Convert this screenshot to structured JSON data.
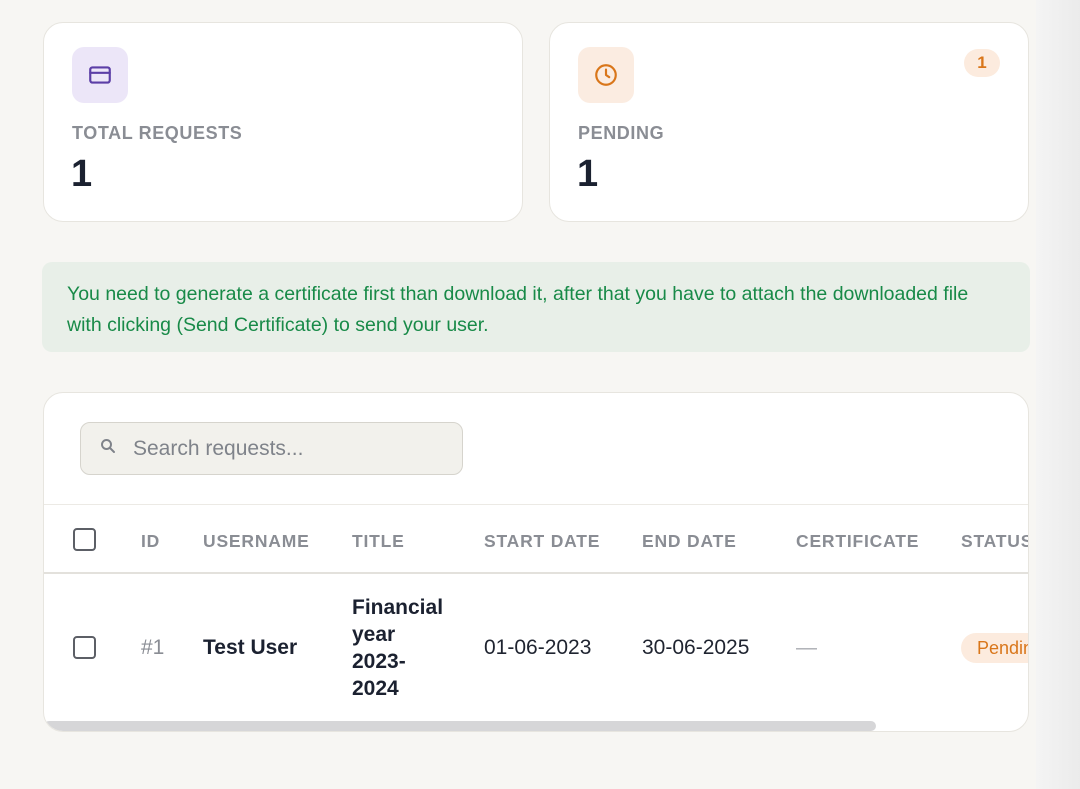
{
  "stats": {
    "total": {
      "label": "TOTAL REQUESTS",
      "value": "1",
      "icon": "card-icon",
      "color": "#5b3ea6"
    },
    "pending": {
      "label": "PENDING",
      "value": "1",
      "badge": "1",
      "icon": "clock-icon",
      "color": "#d9761a"
    }
  },
  "notice": {
    "text": "You need to generate a certificate first than download it, after that you have to attach the downloaded file with clicking (Send Certificate) to send your user."
  },
  "search": {
    "placeholder": "Search requests..."
  },
  "table": {
    "columns": {
      "id": "ID",
      "username": "USERNAME",
      "title": "TITLE",
      "start_date": "START DATE",
      "end_date": "END DATE",
      "certificate": "CERTIFICATE",
      "status": "STATUS"
    },
    "rows": [
      {
        "id": "#1",
        "username": "Test User",
        "title": "Financial year 2023-2024",
        "start_date": "01-06-2023",
        "end_date": "30-06-2025",
        "certificate": "—",
        "status": "Pending",
        "status_color": "#d9761a"
      }
    ]
  }
}
